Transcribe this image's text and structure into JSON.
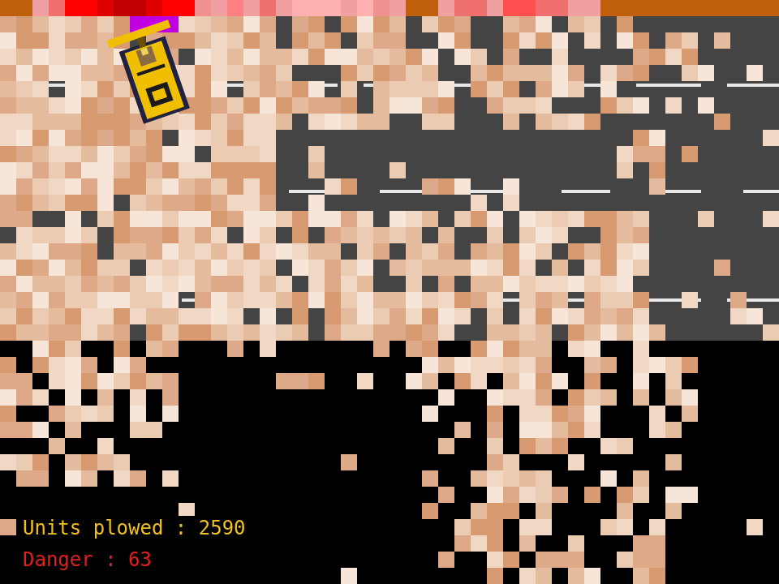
{
  "hud": {
    "units_plowed": "Units plowed : 2590",
    "danger": "Danger : 63"
  }
}
